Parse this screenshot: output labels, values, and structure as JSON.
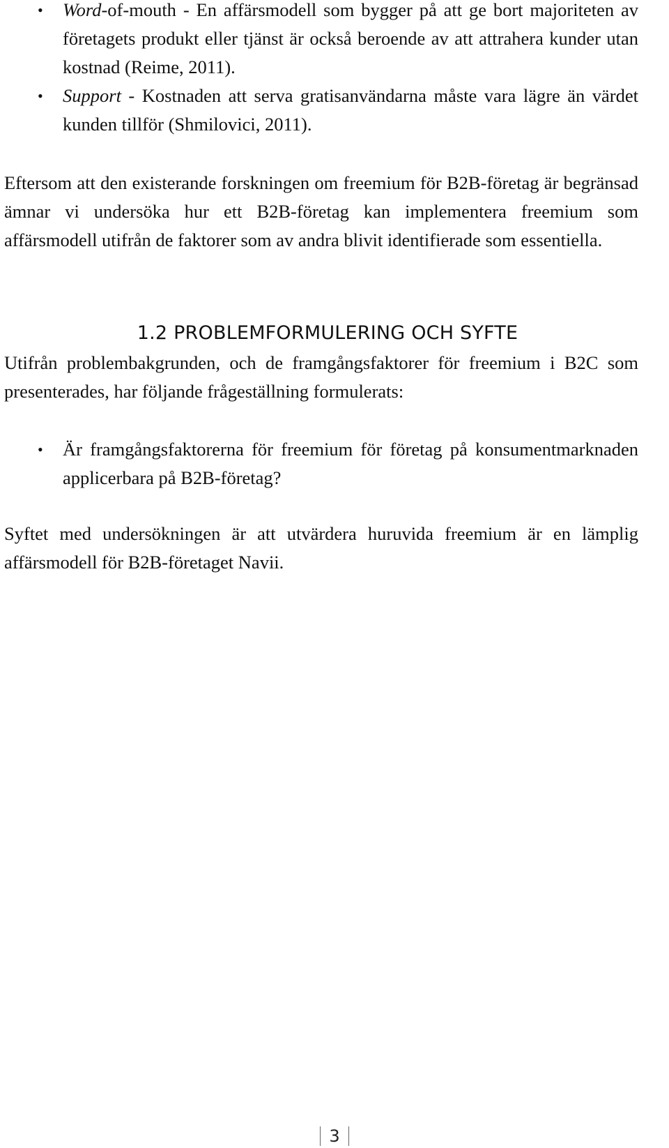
{
  "intro_list": [
    {
      "term": "Word",
      "term_rest": "-of-mouth",
      "text": " - En affärsmodell som bygger på att ge bort majoriteten av företagets produkt eller tjänst är också beroende av att attrahera kunder utan kostnad (Reime, 2011)."
    },
    {
      "term": "Support",
      "term_rest": "",
      "text": " - Kostnaden att serva gratisanvändarna måste vara lägre än värdet kunden tillför (Shmilovici, 2011)."
    }
  ],
  "paragraph_research": "Eftersom att den existerande forskningen om freemium för B2B-företag är begränsad ämnar vi undersöka hur ett B2B-företag kan implementera freemium som affärsmodell utifrån de faktorer som av andra blivit identifierade som essentiella.",
  "section_heading": "1.2 PROBLEMFORMULERING OCH SYFTE",
  "paragraph_background": "Utifrån problembakgrunden, och de framgångsfaktorer för freemium i B2C som presenterades, har följande frågeställning formulerats:",
  "question_list": [
    "Är framgångsfaktorerna för freemium för företag på konsumentmarknaden applicerbara på B2B-företag?"
  ],
  "paragraph_purpose": "Syftet med undersökningen är att utvärdera huruvida freemium är en lämplig affärsmodell för B2B-företaget Navii.",
  "bullet_symbol": "•",
  "footer": {
    "page_number": "3"
  }
}
